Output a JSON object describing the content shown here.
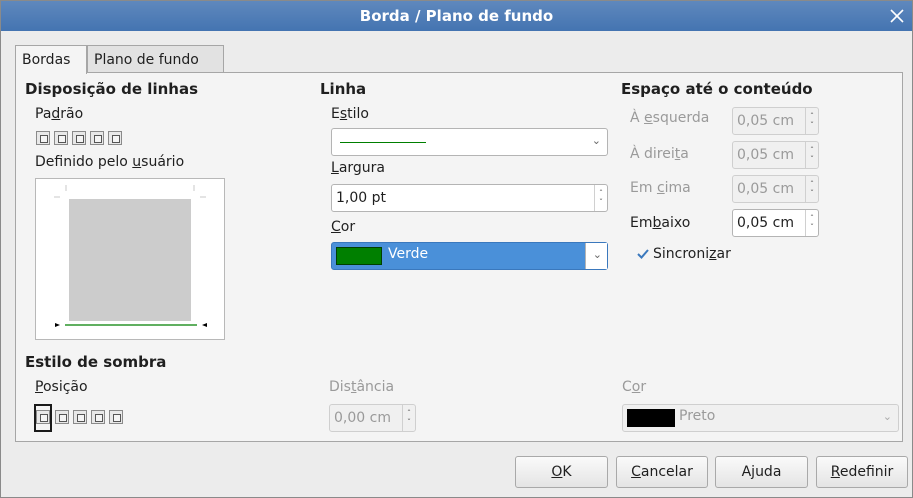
{
  "window": {
    "title": "Borda / Plano de fundo"
  },
  "tabs": [
    {
      "label": "Bordas"
    },
    {
      "label": "Plano de fundo"
    }
  ],
  "line_arrangement": {
    "heading": "Disposição de linhas",
    "default_label_pre": "Pa",
    "default_label_u": "d",
    "default_label_post": "rão",
    "user_label_pre": "Definido pelo ",
    "user_label_u": "u",
    "user_label_post": "suário"
  },
  "line": {
    "heading": "Linha",
    "style_label_pre": "E",
    "style_label_u": "s",
    "style_label_post": "tilo",
    "width_label_pre": "",
    "width_label_u": "L",
    "width_label_post": "argura",
    "width_value": "1,00 pt",
    "color_label_pre": "",
    "color_label_u": "C",
    "color_label_post": "or",
    "color_value": "Verde",
    "color_hex": "#007f00"
  },
  "spacing": {
    "heading": "Espaço até o conteúdo",
    "left_label_pre": "À ",
    "left_label_u": "e",
    "left_label_post": "squerda",
    "left_value": "0,05 cm",
    "right_label_pre": "À direi",
    "right_label_u": "t",
    "right_label_post": "a",
    "right_value": "0,05 cm",
    "top_label_pre": "Em ",
    "top_label_u": "c",
    "top_label_post": "ima",
    "top_value": "0,05 cm",
    "bottom_label_pre": "Em",
    "bottom_label_u": "b",
    "bottom_label_post": "aixo",
    "bottom_value": "0,05 cm",
    "sync_label_pre": "Sincroni",
    "sync_label_u": "z",
    "sync_label_post": "ar"
  },
  "shadow": {
    "heading": "Estilo de sombra",
    "position_label_pre": "",
    "position_label_u": "P",
    "position_label_post": "osição",
    "distance_label_pre": "Dis",
    "distance_label_u": "t",
    "distance_label_post": "ância",
    "distance_value": "0,00 cm",
    "color_label_pre": "C",
    "color_label_u": "o",
    "color_label_post": "r",
    "color_value": "Preto",
    "color_hex": "#000000"
  },
  "buttons": {
    "ok_u": "O",
    "ok_post": "K",
    "cancel_u": "C",
    "cancel_post": "ancelar",
    "help_pre": "A",
    "help_u": "j",
    "help_post": "uda",
    "reset_u": "R",
    "reset_post": "edefinir"
  }
}
